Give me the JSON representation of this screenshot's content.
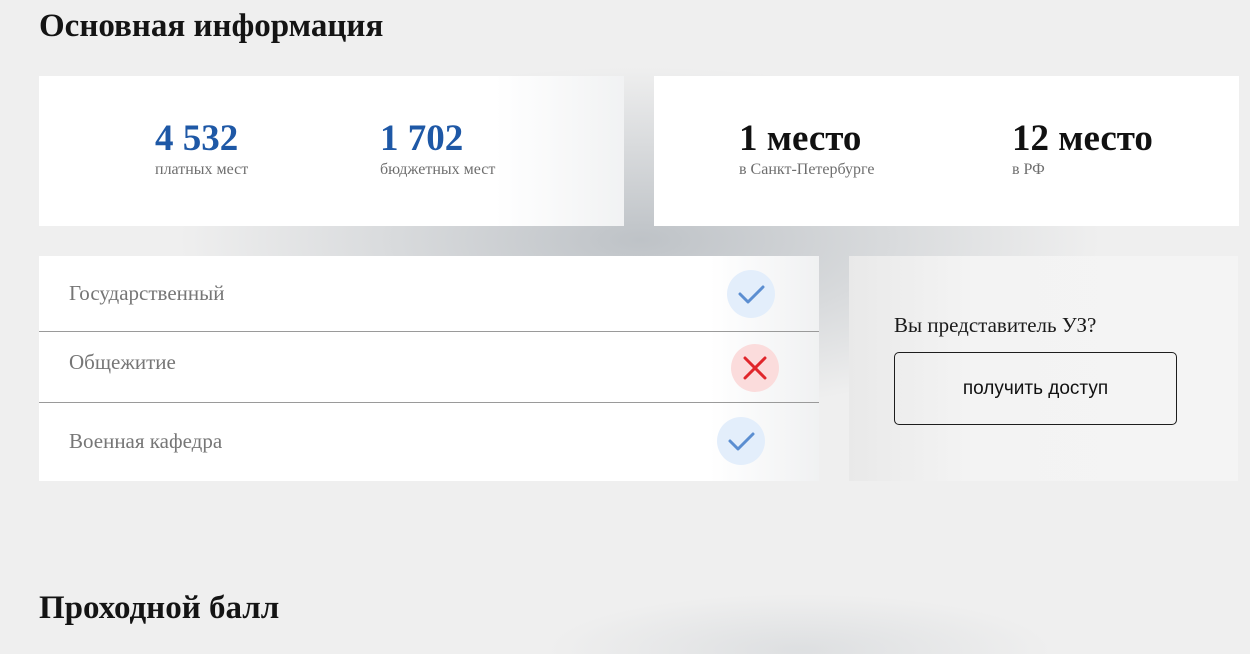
{
  "main_info": {
    "title": "Основная информация"
  },
  "seats": {
    "paid": {
      "value": "4 532",
      "label": "платных мест"
    },
    "budget": {
      "value": "1 702",
      "label": "бюджетных мест"
    }
  },
  "ranking": {
    "city": {
      "value": "1 место",
      "label": "в Санкт-Петербурге"
    },
    "country": {
      "value": "12 место",
      "label": "в РФ"
    }
  },
  "features": [
    {
      "label": "Государственный",
      "status": true,
      "icon": "check-icon"
    },
    {
      "label": "Общежитие",
      "status": false,
      "icon": "cross-icon"
    },
    {
      "label": "Военная кафедра",
      "status": true,
      "icon": "check-icon"
    }
  ],
  "access": {
    "question": "Вы представитель УЗ?",
    "button_label": "получить доступ"
  },
  "passing_score": {
    "title": "Проходной балл"
  },
  "colors": {
    "accent_blue": "#1e58a6",
    "check_blue": "#5b8ed1",
    "cross_red": "#e0262b",
    "check_bg": "#e3eefb",
    "cross_bg": "#fbdcdc"
  }
}
